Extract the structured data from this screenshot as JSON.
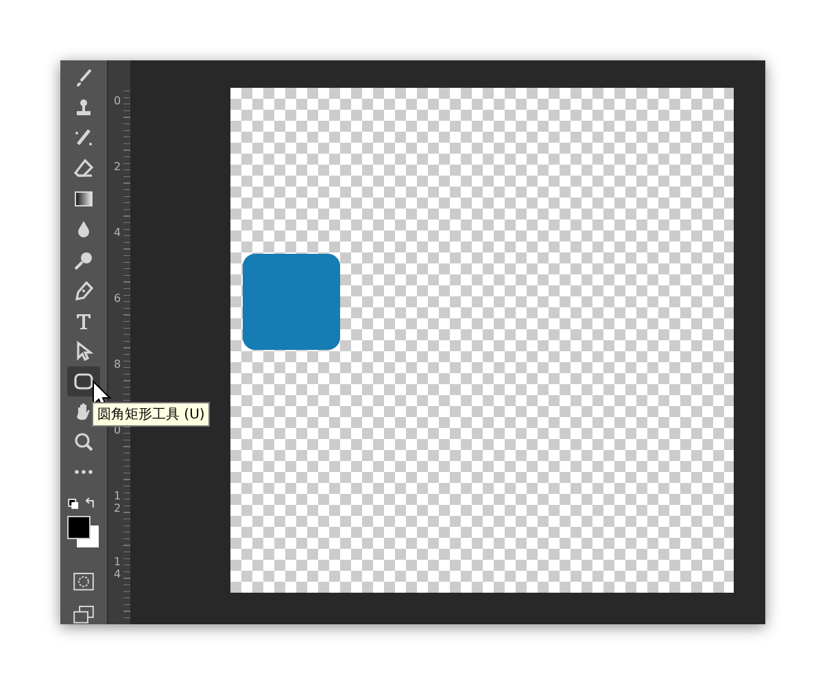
{
  "toolbar": {
    "tools": [
      {
        "kind": "brush",
        "selected": false
      },
      {
        "kind": "stamp",
        "selected": false
      },
      {
        "kind": "healing",
        "selected": false
      },
      {
        "kind": "eraser",
        "selected": false
      },
      {
        "kind": "gradient",
        "selected": false
      },
      {
        "kind": "drop",
        "selected": false
      },
      {
        "kind": "dodge",
        "selected": false
      },
      {
        "kind": "pen",
        "selected": false
      },
      {
        "kind": "type",
        "selected": false
      },
      {
        "kind": "select",
        "selected": false
      },
      {
        "kind": "rounded-rect",
        "selected": true
      },
      {
        "kind": "hand",
        "selected": false
      },
      {
        "kind": "zoom",
        "selected": false
      },
      {
        "kind": "more",
        "selected": false
      }
    ]
  },
  "tooltip": "圆角矩形工具 (U)",
  "ruler": {
    "labels": [
      "0",
      "2",
      "4",
      "6",
      "8",
      "0",
      "12",
      "14"
    ]
  },
  "canvas": {
    "shapes": [
      {
        "kind": "rounded-rect",
        "color": "#167cb4"
      }
    ]
  }
}
